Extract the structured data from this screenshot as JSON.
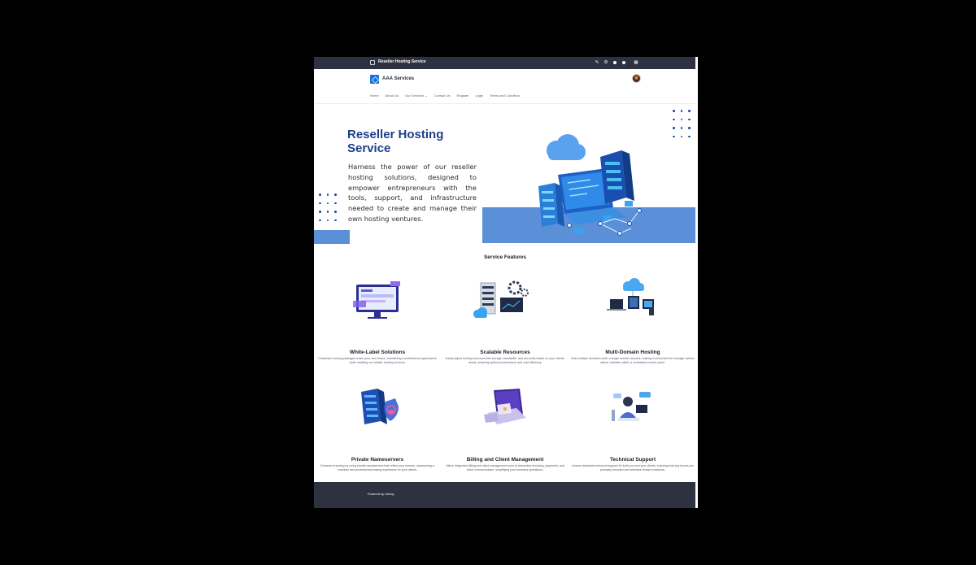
{
  "control_bar": {
    "title": "Reseller Hosting Service",
    "icons": [
      "pencil-icon",
      "gear-icon",
      "dot-icon",
      "info-icon",
      "grid-icon"
    ]
  },
  "header": {
    "site_name": "AAA Services",
    "nav": [
      "Home",
      "About Us",
      "Our Services",
      "Contact Us",
      "Register",
      "Login",
      "Terms and Condition"
    ]
  },
  "hero": {
    "title": "Reseller Hosting Service",
    "description": "Harness the power of our reseller hosting solutions, designed to empower entrepreneurs with the tools, support, and infrastructure needed to create and manage their own hosting ventures."
  },
  "features": {
    "section_title": "Service Features",
    "items": [
      {
        "title": "White-Label Solutions",
        "description": "Customize hosting packages under your own brand, maintaining a professional appearance while reselling our reliable hosting services."
      },
      {
        "title": "Scalable Resources",
        "description": "Easily adjust hosting resources like storage, bandwidth, and accounts based on your clients' needs, ensuring optimal performance and cost efficiency."
      },
      {
        "title": "Multi-Domain Hosting",
        "description": "Host multiple domains under a single reseller account, making it convenient for manage various clients' websites within a centralized control panel."
      },
      {
        "title": "Private Nameservers",
        "description": "Enhance branding by using private nameservers that reflect your domain, showcasing a cohesive and professional hosting experience for your clients."
      },
      {
        "title": "Billing and Client Management",
        "description": "Utilize integrated billing and client management tools to streamline invoicing, payments, and client communication, simplifying your business operations."
      },
      {
        "title": "Technical Support",
        "description": "Access dedicated technical support for both you and your clients, ensuring that any issues are promptly resolved and websites remain functional."
      }
    ]
  },
  "footer": {
    "powered_by": "Powered by Liferay"
  },
  "colors": {
    "dark_bar": "#2e3140",
    "hero_title": "#1d3f8a",
    "accent_block": "#5b8fd8",
    "logo_blue": "#1b6fe0"
  }
}
